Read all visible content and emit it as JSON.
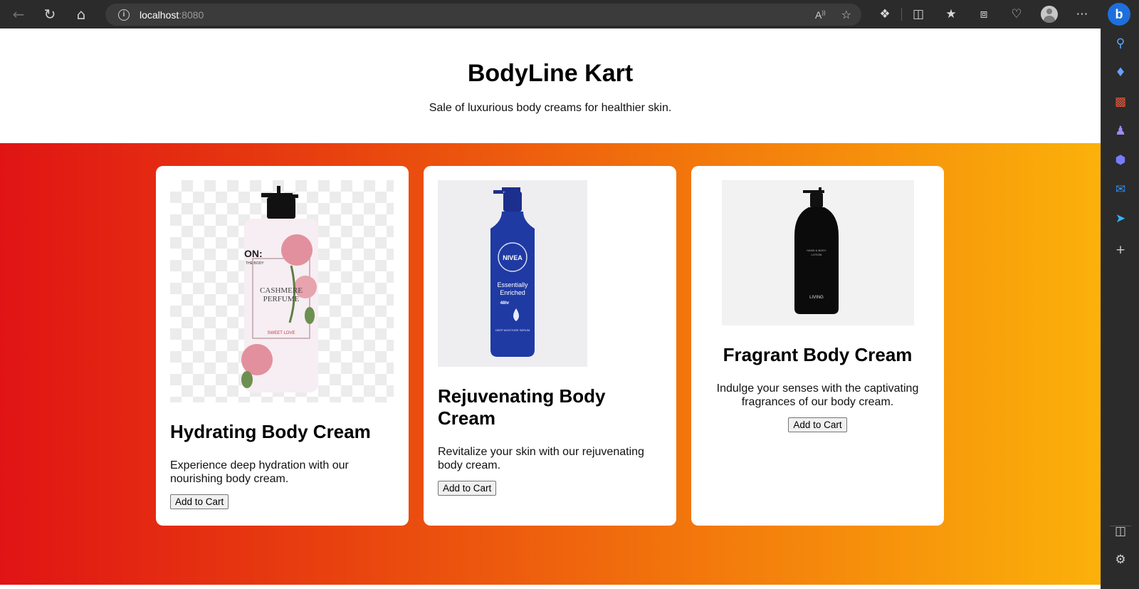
{
  "browser": {
    "url_host": "localhost",
    "url_port": ":8080"
  },
  "page": {
    "title": "BodyLine Kart",
    "subtitle": "Sale of luxurious body creams for healthier skin."
  },
  "products": [
    {
      "name": "Hydrating Body Cream",
      "description": "Experience deep hydration with our nourishing body cream.",
      "button": "Add to Cart",
      "image_label": "cashmere-perfume-lotion-bottle",
      "bottle_text": [
        "ON:",
        "THE BODY",
        "CASHMERE",
        "PERFUME",
        "SWEET LOVE"
      ]
    },
    {
      "name": "Rejuvenating Body Cream",
      "description": "Revitalize your skin with our rejuvenating body cream.",
      "button": "Add to Cart",
      "image_label": "nivea-lotion-bottle",
      "bottle_text": [
        "NIVEA",
        "Essentially",
        "Enriched",
        "48hr",
        "DEEP MOISTURE SERUM"
      ]
    },
    {
      "name": "Fragrant Body Cream",
      "description": "Indulge your senses with the captivating fragrances of our body cream.",
      "button": "Add to Cart",
      "image_label": "black-lotion-bottle",
      "bottle_text": [
        "HAND & BODY",
        "LOTION",
        "LIVING"
      ]
    }
  ],
  "colors": {
    "gradient_start": "#e01414",
    "gradient_end": "#fbb10a",
    "chrome_bg": "#2b2b2b"
  }
}
